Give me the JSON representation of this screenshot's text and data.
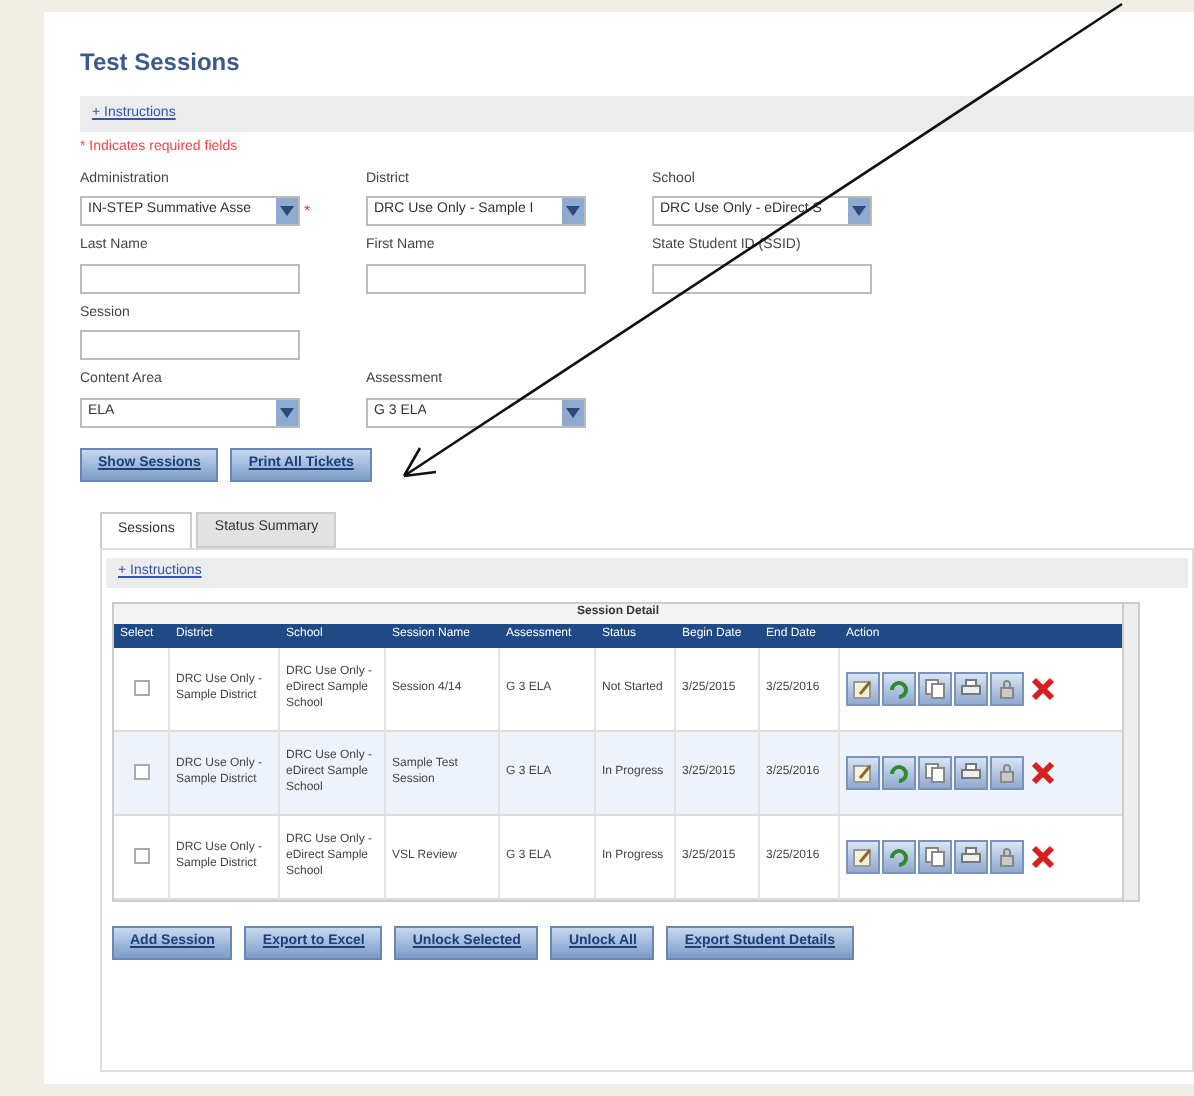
{
  "title": "Test Sessions",
  "instructions_link": "+ Instructions",
  "required_note": "* Indicates required fields",
  "filter_rows": [
    [
      {
        "kind": "select",
        "label": "Administration",
        "value": "IN-STEP Summative Asse",
        "required_mark": "*"
      },
      {
        "kind": "select",
        "label": "District",
        "value": "DRC Use Only - Sample I"
      },
      {
        "kind": "select",
        "label": "School",
        "value": "DRC Use Only - eDirect S"
      }
    ],
    [
      {
        "kind": "text",
        "label": "Last Name"
      },
      {
        "kind": "text",
        "label": "First Name"
      },
      {
        "kind": "text",
        "label": "State Student ID (SSID)"
      }
    ],
    [
      {
        "kind": "text",
        "label": "Session"
      }
    ],
    [
      {
        "kind": "select",
        "label": "Content Area",
        "value": "ELA"
      },
      {
        "kind": "select",
        "label": "Assessment",
        "value": "G 3 ELA"
      }
    ]
  ],
  "buttons": [
    "Show Sessions",
    "Print All Tickets"
  ],
  "tabs": [
    {
      "label": "Sessions",
      "selected": true
    },
    {
      "label": "Status Summary",
      "selected": false
    }
  ],
  "panel": {
    "instructions_link": "+ Instructions",
    "table": {
      "caption": "Session Detail",
      "columns": [
        "Select",
        "District",
        "School",
        "Session Name",
        "Assessment",
        "Status",
        "Begin Date",
        "End Date",
        "Action"
      ],
      "rows": [
        {
          "checked": false,
          "cells": [
            "",
            "DRC Use Only - Sample District",
            "DRC Use Only - eDirect Sample School",
            "Session 4/14",
            "G 3 ELA",
            "Not Started",
            "3/25/2015",
            "3/25/2016"
          ],
          "actions": [
            {
              "kind": "edit"
            },
            {
              "kind": "refresh"
            },
            {
              "kind": "copy"
            },
            {
              "kind": "print"
            },
            {
              "kind": "lock"
            },
            {
              "kind": "delete"
            }
          ]
        },
        {
          "checked": false,
          "cells": [
            "",
            "DRC Use Only - Sample District",
            "DRC Use Only - eDirect Sample School",
            "Sample Test Session",
            "G 3 ELA",
            "In Progress",
            "3/25/2015",
            "3/25/2016"
          ],
          "actions": [
            {
              "kind": "edit"
            },
            {
              "kind": "refresh"
            },
            {
              "kind": "copy"
            },
            {
              "kind": "print"
            },
            {
              "kind": "lock"
            },
            {
              "kind": "delete"
            }
          ]
        },
        {
          "checked": false,
          "cells": [
            "",
            "DRC Use Only - Sample District",
            "DRC Use Only - eDirect Sample School",
            "VSL Review",
            "G 3 ELA",
            "In Progress",
            "3/25/2015",
            "3/25/2016"
          ],
          "actions": [
            {
              "kind": "edit"
            },
            {
              "kind": "refresh"
            },
            {
              "kind": "copy"
            },
            {
              "kind": "print"
            },
            {
              "kind": "lock"
            },
            {
              "kind": "delete"
            }
          ]
        }
      ]
    }
  },
  "footer_buttons": [
    "Add Session",
    "Export to Excel",
    "Unlock Selected",
    "Unlock All",
    "Export Student Details"
  ]
}
